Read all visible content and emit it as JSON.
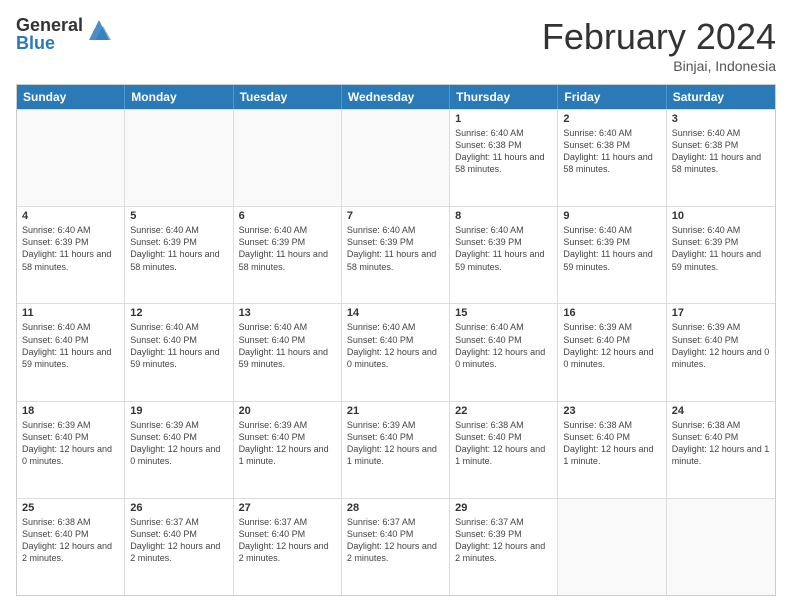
{
  "logo": {
    "general": "General",
    "blue": "Blue"
  },
  "title": "February 2024",
  "location": "Binjai, Indonesia",
  "days": [
    "Sunday",
    "Monday",
    "Tuesday",
    "Wednesday",
    "Thursday",
    "Friday",
    "Saturday"
  ],
  "rows": [
    [
      {
        "day": "",
        "info": "",
        "empty": true
      },
      {
        "day": "",
        "info": "",
        "empty": true
      },
      {
        "day": "",
        "info": "",
        "empty": true
      },
      {
        "day": "",
        "info": "",
        "empty": true
      },
      {
        "day": "1",
        "info": "Sunrise: 6:40 AM\nSunset: 6:38 PM\nDaylight: 11 hours\nand 58 minutes."
      },
      {
        "day": "2",
        "info": "Sunrise: 6:40 AM\nSunset: 6:38 PM\nDaylight: 11 hours\nand 58 minutes."
      },
      {
        "day": "3",
        "info": "Sunrise: 6:40 AM\nSunset: 6:38 PM\nDaylight: 11 hours\nand 58 minutes."
      }
    ],
    [
      {
        "day": "4",
        "info": "Sunrise: 6:40 AM\nSunset: 6:39 PM\nDaylight: 11 hours\nand 58 minutes."
      },
      {
        "day": "5",
        "info": "Sunrise: 6:40 AM\nSunset: 6:39 PM\nDaylight: 11 hours\nand 58 minutes."
      },
      {
        "day": "6",
        "info": "Sunrise: 6:40 AM\nSunset: 6:39 PM\nDaylight: 11 hours\nand 58 minutes."
      },
      {
        "day": "7",
        "info": "Sunrise: 6:40 AM\nSunset: 6:39 PM\nDaylight: 11 hours\nand 58 minutes."
      },
      {
        "day": "8",
        "info": "Sunrise: 6:40 AM\nSunset: 6:39 PM\nDaylight: 11 hours\nand 59 minutes."
      },
      {
        "day": "9",
        "info": "Sunrise: 6:40 AM\nSunset: 6:39 PM\nDaylight: 11 hours\nand 59 minutes."
      },
      {
        "day": "10",
        "info": "Sunrise: 6:40 AM\nSunset: 6:39 PM\nDaylight: 11 hours\nand 59 minutes."
      }
    ],
    [
      {
        "day": "11",
        "info": "Sunrise: 6:40 AM\nSunset: 6:40 PM\nDaylight: 11 hours\nand 59 minutes."
      },
      {
        "day": "12",
        "info": "Sunrise: 6:40 AM\nSunset: 6:40 PM\nDaylight: 11 hours\nand 59 minutes."
      },
      {
        "day": "13",
        "info": "Sunrise: 6:40 AM\nSunset: 6:40 PM\nDaylight: 11 hours\nand 59 minutes."
      },
      {
        "day": "14",
        "info": "Sunrise: 6:40 AM\nSunset: 6:40 PM\nDaylight: 12 hours\nand 0 minutes."
      },
      {
        "day": "15",
        "info": "Sunrise: 6:40 AM\nSunset: 6:40 PM\nDaylight: 12 hours\nand 0 minutes."
      },
      {
        "day": "16",
        "info": "Sunrise: 6:39 AM\nSunset: 6:40 PM\nDaylight: 12 hours\nand 0 minutes."
      },
      {
        "day": "17",
        "info": "Sunrise: 6:39 AM\nSunset: 6:40 PM\nDaylight: 12 hours\nand 0 minutes."
      }
    ],
    [
      {
        "day": "18",
        "info": "Sunrise: 6:39 AM\nSunset: 6:40 PM\nDaylight: 12 hours\nand 0 minutes."
      },
      {
        "day": "19",
        "info": "Sunrise: 6:39 AM\nSunset: 6:40 PM\nDaylight: 12 hours\nand 0 minutes."
      },
      {
        "day": "20",
        "info": "Sunrise: 6:39 AM\nSunset: 6:40 PM\nDaylight: 12 hours\nand 1 minute."
      },
      {
        "day": "21",
        "info": "Sunrise: 6:39 AM\nSunset: 6:40 PM\nDaylight: 12 hours\nand 1 minute."
      },
      {
        "day": "22",
        "info": "Sunrise: 6:38 AM\nSunset: 6:40 PM\nDaylight: 12 hours\nand 1 minute."
      },
      {
        "day": "23",
        "info": "Sunrise: 6:38 AM\nSunset: 6:40 PM\nDaylight: 12 hours\nand 1 minute."
      },
      {
        "day": "24",
        "info": "Sunrise: 6:38 AM\nSunset: 6:40 PM\nDaylight: 12 hours\nand 1 minute."
      }
    ],
    [
      {
        "day": "25",
        "info": "Sunrise: 6:38 AM\nSunset: 6:40 PM\nDaylight: 12 hours\nand 2 minutes."
      },
      {
        "day": "26",
        "info": "Sunrise: 6:37 AM\nSunset: 6:40 PM\nDaylight: 12 hours\nand 2 minutes."
      },
      {
        "day": "27",
        "info": "Sunrise: 6:37 AM\nSunset: 6:40 PM\nDaylight: 12 hours\nand 2 minutes."
      },
      {
        "day": "28",
        "info": "Sunrise: 6:37 AM\nSunset: 6:40 PM\nDaylight: 12 hours\nand 2 minutes."
      },
      {
        "day": "29",
        "info": "Sunrise: 6:37 AM\nSunset: 6:39 PM\nDaylight: 12 hours\nand 2 minutes."
      },
      {
        "day": "",
        "info": "",
        "empty": true
      },
      {
        "day": "",
        "info": "",
        "empty": true
      }
    ]
  ]
}
